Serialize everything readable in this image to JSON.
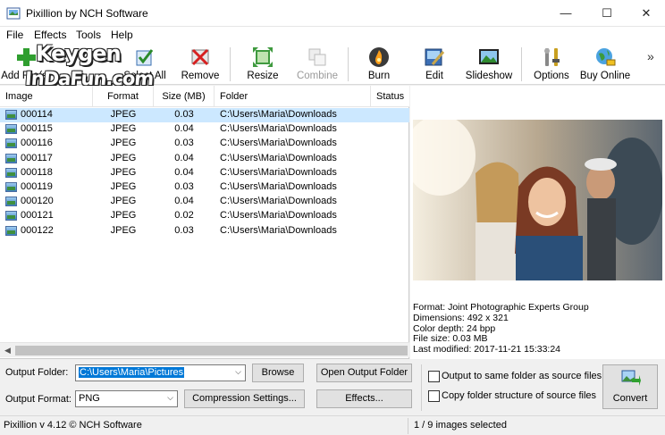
{
  "window": {
    "title": "Pixillion by NCH Software"
  },
  "menu": [
    "File",
    "Effects",
    "Tools",
    "Help"
  ],
  "toolbar": {
    "add_files": "Add File(s)",
    "select_all": "Select All",
    "remove": "Remove",
    "resize": "Resize",
    "combine": "Combine",
    "burn": "Burn",
    "edit": "Edit",
    "slideshow": "Slideshow",
    "options": "Options",
    "buy_online": "Buy Online",
    "overflow": "»"
  },
  "watermark": {
    "line1": "Keygen",
    "line2": "InDaFun.com"
  },
  "columns": {
    "image": "Image",
    "format": "Format",
    "size": "Size (MB)",
    "folder": "Folder",
    "status": "Status"
  },
  "files": [
    {
      "name": "000114",
      "format": "JPEG",
      "size": "0.03",
      "folder": "C:\\Users\\Maria\\Downloads"
    },
    {
      "name": "000115",
      "format": "JPEG",
      "size": "0.04",
      "folder": "C:\\Users\\Maria\\Downloads"
    },
    {
      "name": "000116",
      "format": "JPEG",
      "size": "0.03",
      "folder": "C:\\Users\\Maria\\Downloads"
    },
    {
      "name": "000117",
      "format": "JPEG",
      "size": "0.04",
      "folder": "C:\\Users\\Maria\\Downloads"
    },
    {
      "name": "000118",
      "format": "JPEG",
      "size": "0.04",
      "folder": "C:\\Users\\Maria\\Downloads"
    },
    {
      "name": "000119",
      "format": "JPEG",
      "size": "0.03",
      "folder": "C:\\Users\\Maria\\Downloads"
    },
    {
      "name": "000120",
      "format": "JPEG",
      "size": "0.04",
      "folder": "C:\\Users\\Maria\\Downloads"
    },
    {
      "name": "000121",
      "format": "JPEG",
      "size": "0.02",
      "folder": "C:\\Users\\Maria\\Downloads"
    },
    {
      "name": "000122",
      "format": "JPEG",
      "size": "0.03",
      "folder": "C:\\Users\\Maria\\Downloads"
    }
  ],
  "preview": {
    "format": "Format: Joint Photographic Experts Group",
    "dimensions": "Dimensions: 492 x 321",
    "color_depth": "Color depth: 24 bpp",
    "file_size": "File size: 0.03 MB",
    "last_modified": "Last modified: 2017-11-21 15:33:24"
  },
  "output": {
    "folder_label": "Output Folder:",
    "folder_value": "C:\\Users\\Maria\\Pictures",
    "browse": "Browse",
    "open_output_folder": "Open Output Folder",
    "format_label": "Output Format:",
    "format_value": "PNG",
    "compression_settings": "Compression Settings...",
    "effects": "Effects...",
    "same_folder": "Output to same folder as source files",
    "copy_structure": "Copy folder structure of source files",
    "convert": "Convert"
  },
  "status": {
    "version": "Pixillion v 4.12 © NCH Software",
    "selection": "1 / 9 images selected"
  },
  "colors": {
    "selection": "#cce8ff",
    "accent": "#0078d7"
  }
}
